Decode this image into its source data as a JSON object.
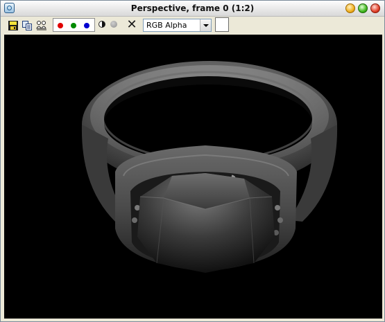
{
  "window": {
    "title": "Perspective, frame 0 (1:2)"
  },
  "titlebar_icons": [
    "app-icon",
    "minimize-button",
    "maximize-button",
    "close-button"
  ],
  "toolbar": {
    "icons": [
      "save-icon",
      "copy-icon",
      "clone-icon",
      "red-channel-icon",
      "green-channel-icon",
      "blue-channel-icon",
      "monochrome-icon",
      "alpha-channel-icon",
      "clear-icon"
    ],
    "channel_select": {
      "selected": "RGB Alpha"
    },
    "clear_glyph": "✕"
  },
  "colors": {
    "red_channel": "#e00000",
    "green_channel": "#008a00",
    "blue_channel": "#0000d0",
    "background": "#ece9d8",
    "viewport": "#000000"
  }
}
